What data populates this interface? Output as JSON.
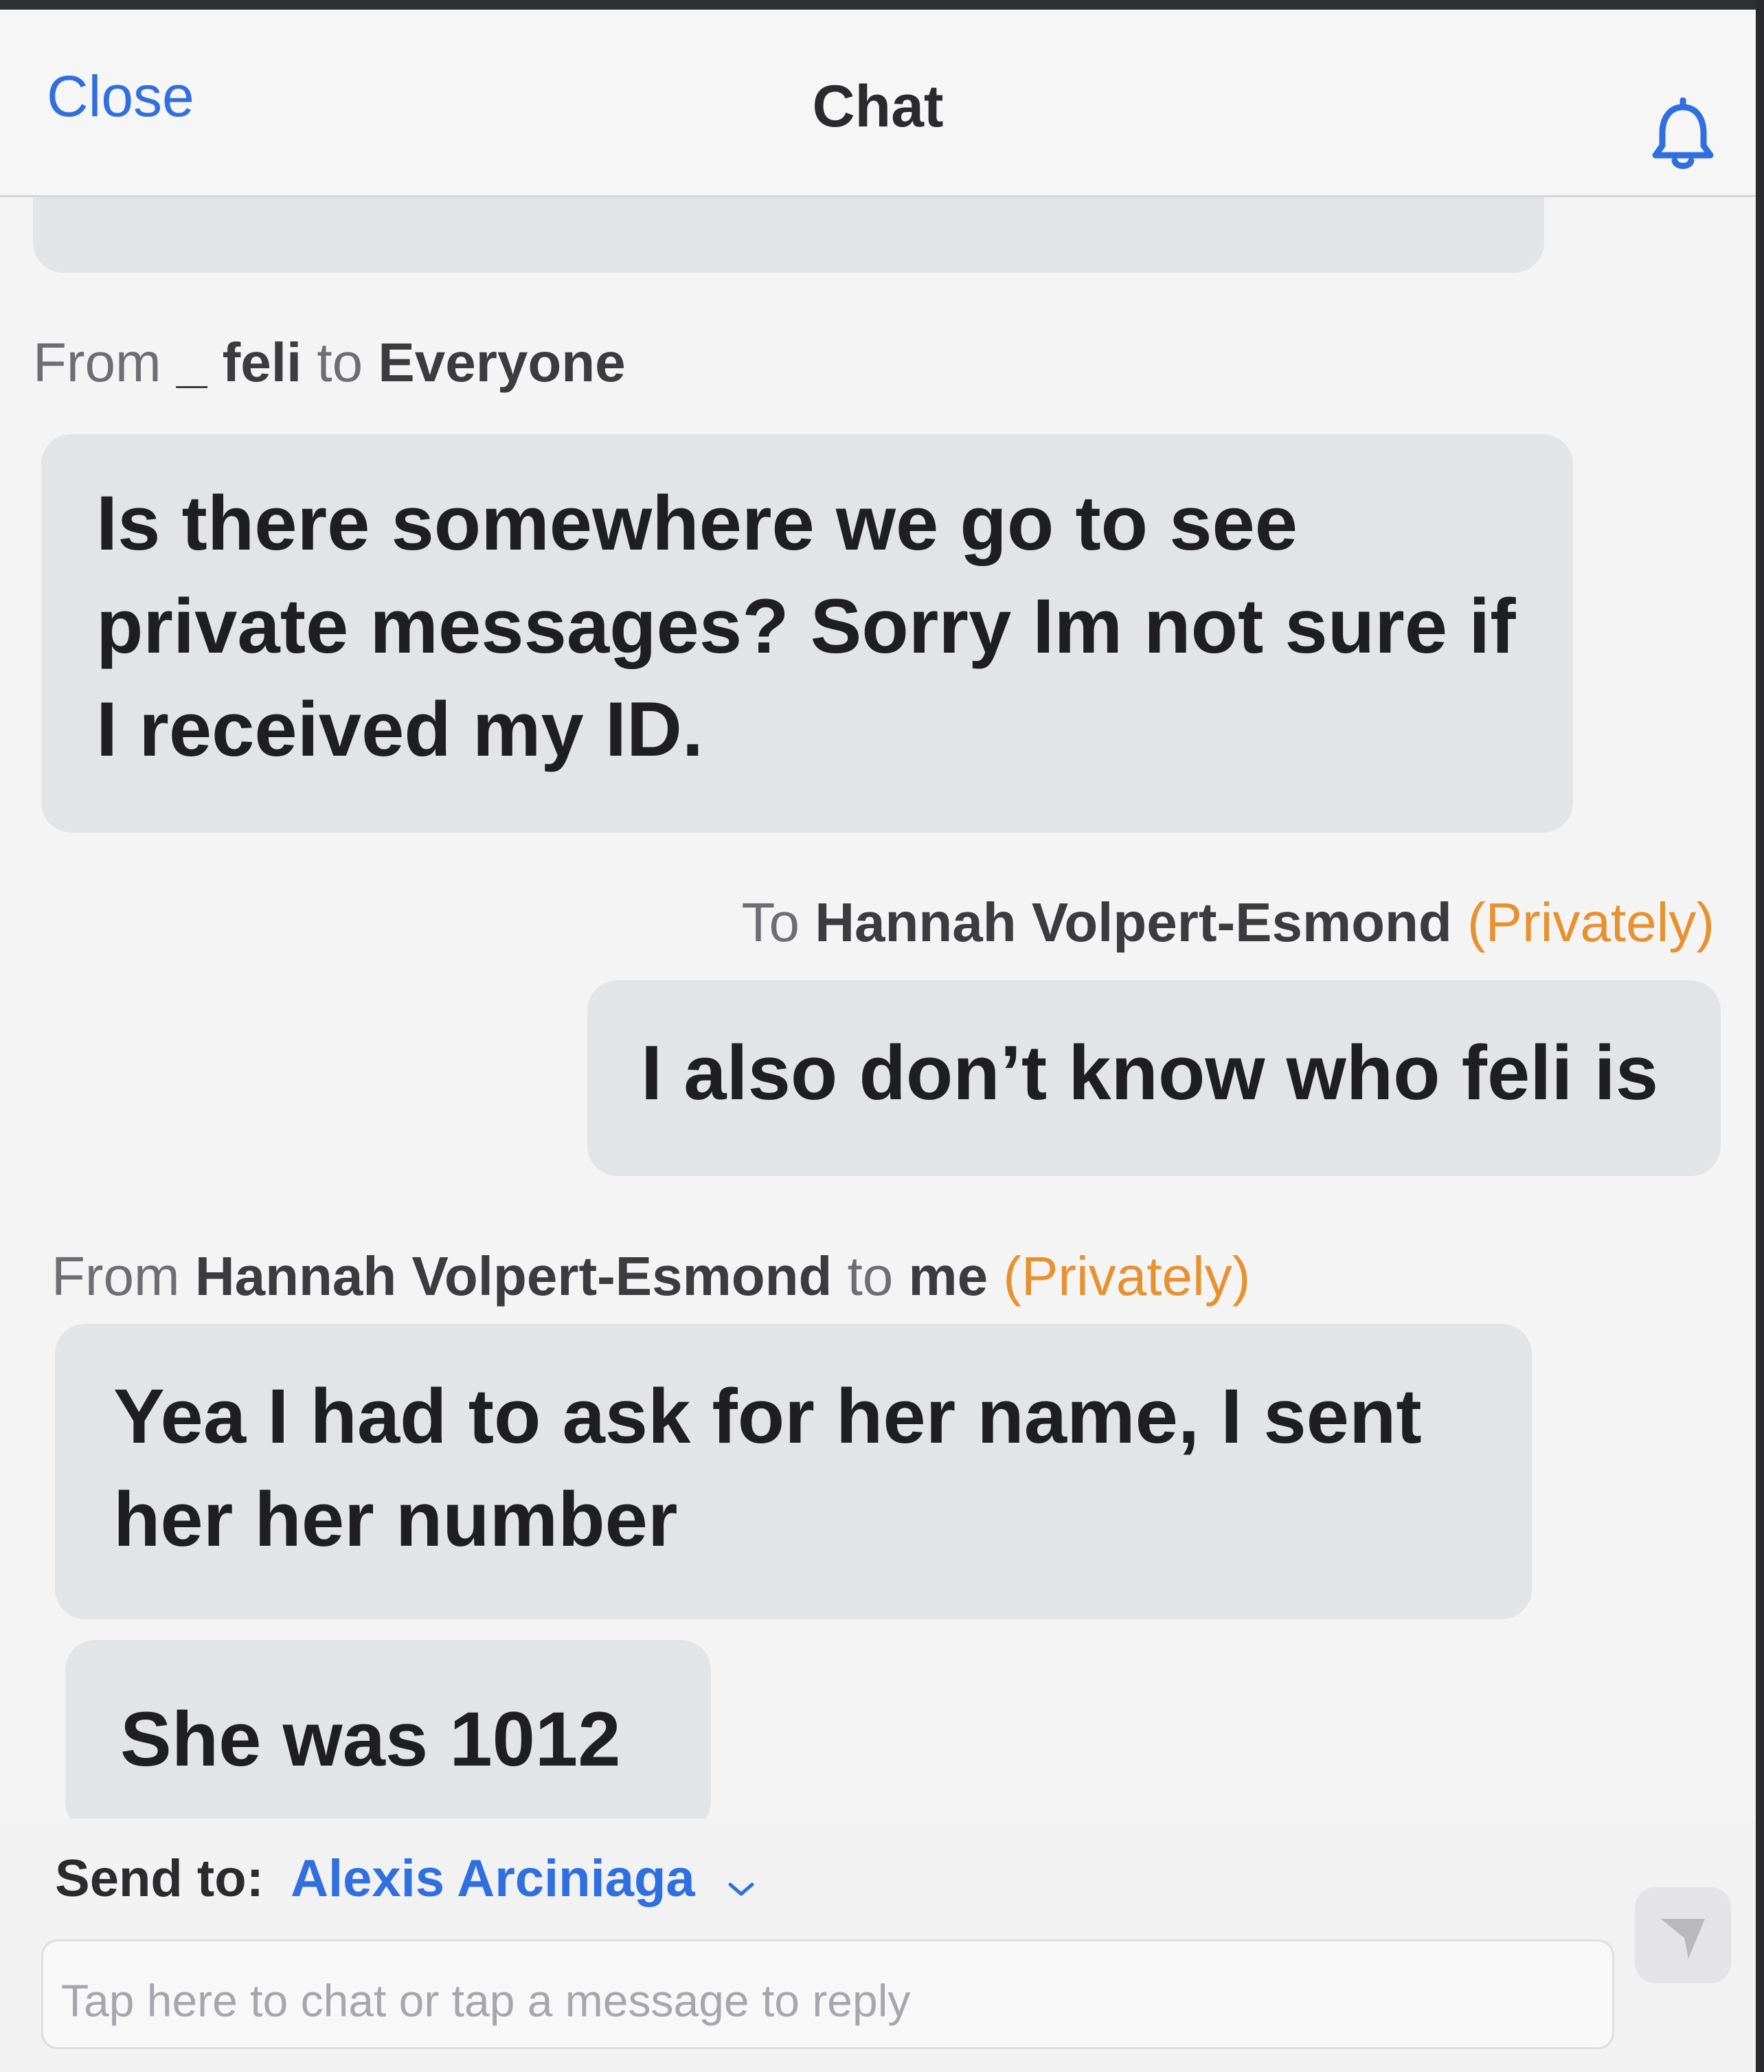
{
  "header": {
    "close_label": "Close",
    "title": "Chat",
    "bell_icon": "bell-icon"
  },
  "messages": [
    {
      "meta": {
        "prefix": "From",
        "sender": "_ feli",
        "connector": "to",
        "recipient": "Everyone",
        "privacy": ""
      },
      "text": "Is there somewhere we go to see private messages? Sorry Im not sure if I received my ID."
    },
    {
      "meta": {
        "prefix": "To",
        "recipient": "Hannah Volpert-Esmond",
        "privacy": "(Privately)"
      },
      "text": "I also don’t know who feli is"
    },
    {
      "meta": {
        "prefix": "From",
        "sender": "Hannah Volpert-Esmond",
        "connector": "to",
        "recipient": "me",
        "privacy": "(Privately)"
      },
      "text": "Yea I had to ask for her name, I sent her her number"
    },
    {
      "text": "She was 1012"
    }
  ],
  "footer": {
    "send_to_label": "Send to:",
    "send_to_value": "Alexis Arciniaga",
    "input_placeholder": "Tap here to chat or tap a message to reply",
    "send_icon": "send-icon"
  },
  "colors": {
    "accent": "#2f6fe0",
    "private": "#e8922f",
    "bubble": "#e3e4e6"
  }
}
